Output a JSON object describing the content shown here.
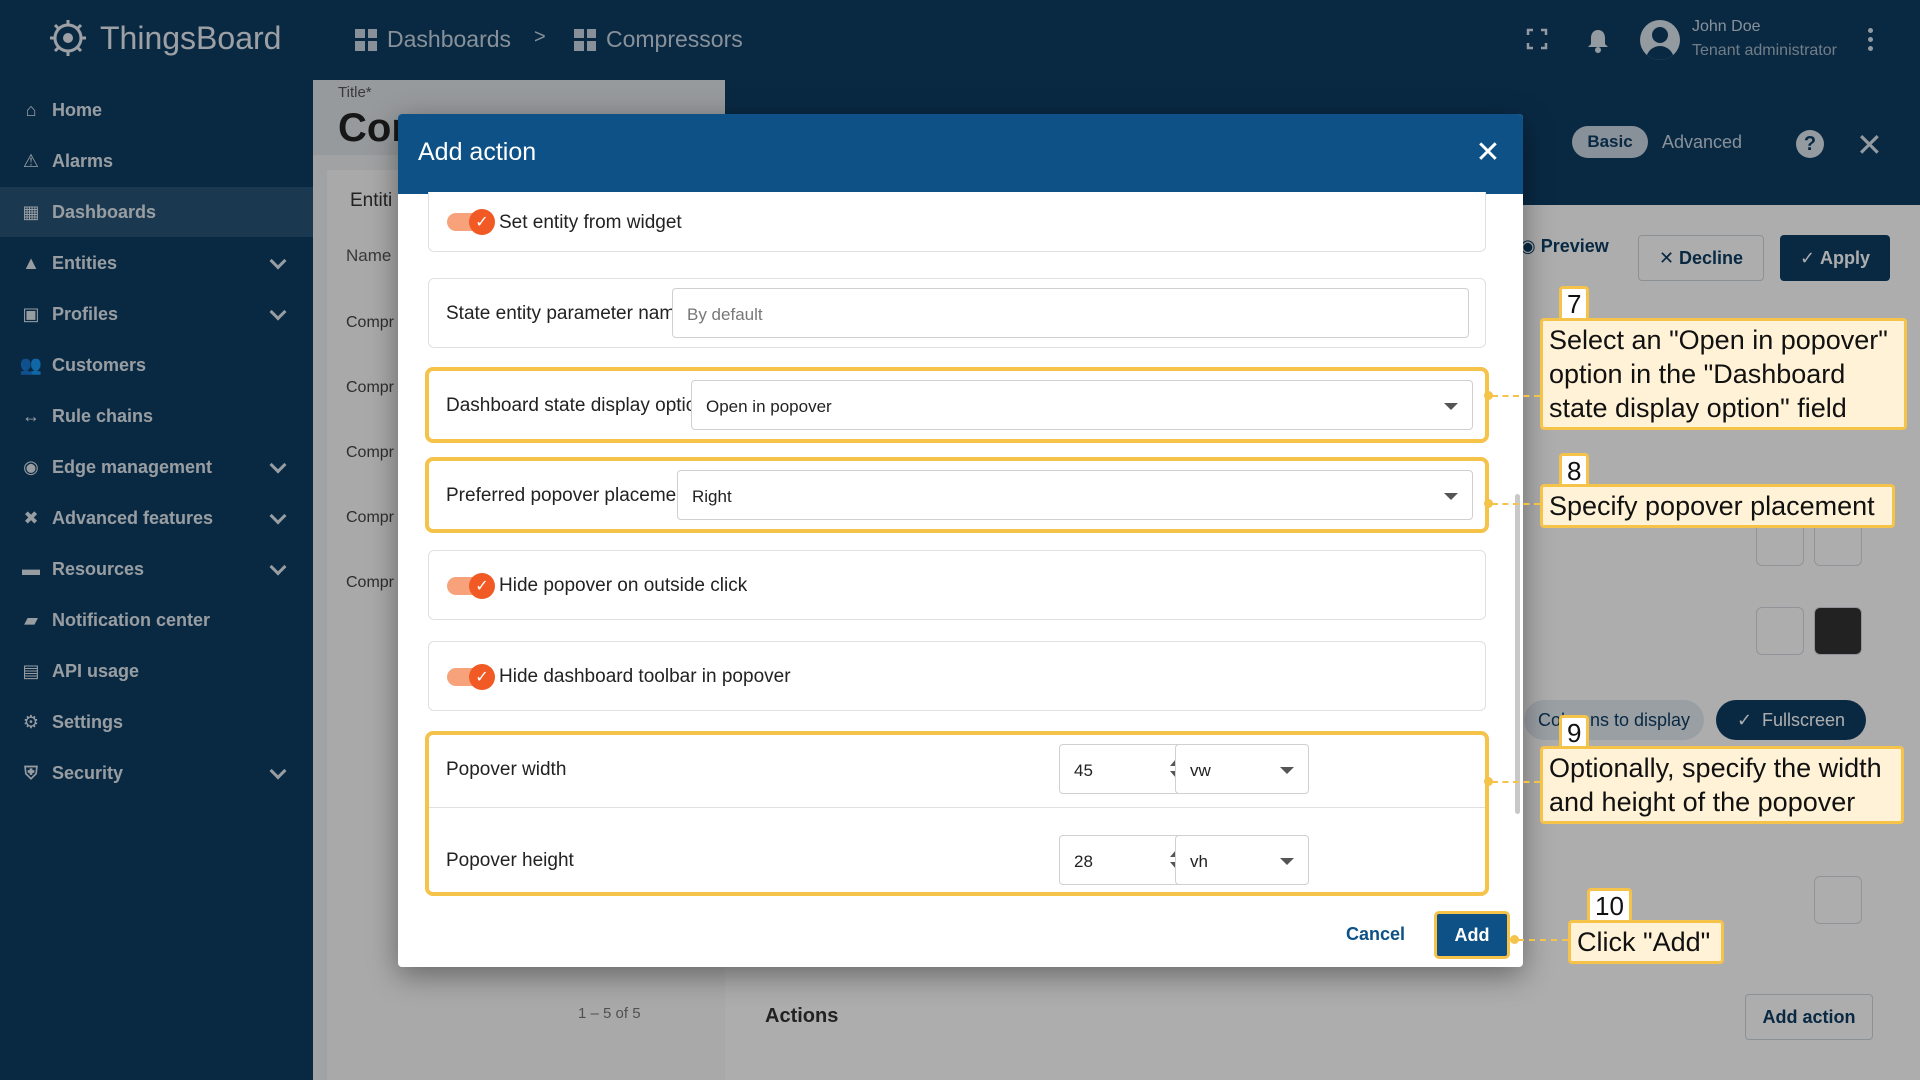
{
  "app": {
    "brand": "ThingsBoard"
  },
  "breadcrumb": {
    "item1": "Dashboards",
    "separator": ">",
    "item2": "Compressors"
  },
  "user": {
    "name": "John Doe",
    "role": "Tenant administrator"
  },
  "sidebar": {
    "items": [
      {
        "label": "Home",
        "icon": "home-icon"
      },
      {
        "label": "Alarms",
        "icon": "warning-icon"
      },
      {
        "label": "Dashboards",
        "icon": "dashboard-icon",
        "active": true
      },
      {
        "label": "Entities",
        "icon": "entities-icon",
        "expandable": true
      },
      {
        "label": "Profiles",
        "icon": "profiles-icon",
        "expandable": true
      },
      {
        "label": "Customers",
        "icon": "customers-icon"
      },
      {
        "label": "Rule chains",
        "icon": "rule-chains-icon"
      },
      {
        "label": "Edge management",
        "icon": "edge-icon",
        "expandable": true
      },
      {
        "label": "Advanced features",
        "icon": "tools-icon",
        "expandable": true
      },
      {
        "label": "Resources",
        "icon": "folder-icon",
        "expandable": true
      },
      {
        "label": "Notification center",
        "icon": "notification-icon"
      },
      {
        "label": "API usage",
        "icon": "chart-icon"
      },
      {
        "label": "Settings",
        "icon": "gear-icon"
      },
      {
        "label": "Security",
        "icon": "shield-icon",
        "expandable": true
      }
    ]
  },
  "background": {
    "title_label": "Title*",
    "title_value": "Cor",
    "table_title": "Entiti",
    "column_name": "Name",
    "rows": [
      "Compr",
      "Compr",
      "Compr",
      "Compr",
      "Compr"
    ],
    "pagination": "1 – 5 of 5",
    "mode_basic": "Basic",
    "mode_advanced": "Advanced",
    "preview": "Preview",
    "decline": "Decline",
    "apply": "Apply",
    "chip_columns": "Columns to display",
    "chip_fullscreen": "Fullscreen",
    "actions_label": "Actions",
    "add_action_button": "Add action"
  },
  "dialog": {
    "title": "Add action",
    "set_entity_from_widget": {
      "label": "Set entity from widget",
      "checked": true
    },
    "state_entity_param": {
      "label": "State entity parameter name",
      "placeholder": "By default",
      "value": ""
    },
    "display_option": {
      "label": "Dashboard state display option",
      "value": "Open in popover"
    },
    "popover_placement": {
      "label": "Preferred popover placement",
      "value": "Right"
    },
    "hide_on_outside_click": {
      "label": "Hide popover on outside click",
      "checked": true
    },
    "hide_toolbar": {
      "label": "Hide dashboard toolbar in popover",
      "checked": true
    },
    "popover_width": {
      "label": "Popover width",
      "value": "45",
      "unit": "vw"
    },
    "popover_height": {
      "label": "Popover height",
      "value": "28",
      "unit": "vh"
    },
    "cancel": "Cancel",
    "add": "Add"
  },
  "callouts": {
    "c7": {
      "num": "7",
      "text": "Select an \"Open in popover\" option in the \"Dashboard state display option\" field"
    },
    "c8": {
      "num": "8",
      "text": "Specify popover placement"
    },
    "c9": {
      "num": "9",
      "text": "Optionally, specify the width and height of the popover"
    },
    "c10": {
      "num": "10",
      "text": "Click \"Add\""
    }
  },
  "colors": {
    "primary": "#0d5186",
    "accent": "#f15a24",
    "highlight": "#f5c24a",
    "sidebar": "#0e3d63"
  }
}
